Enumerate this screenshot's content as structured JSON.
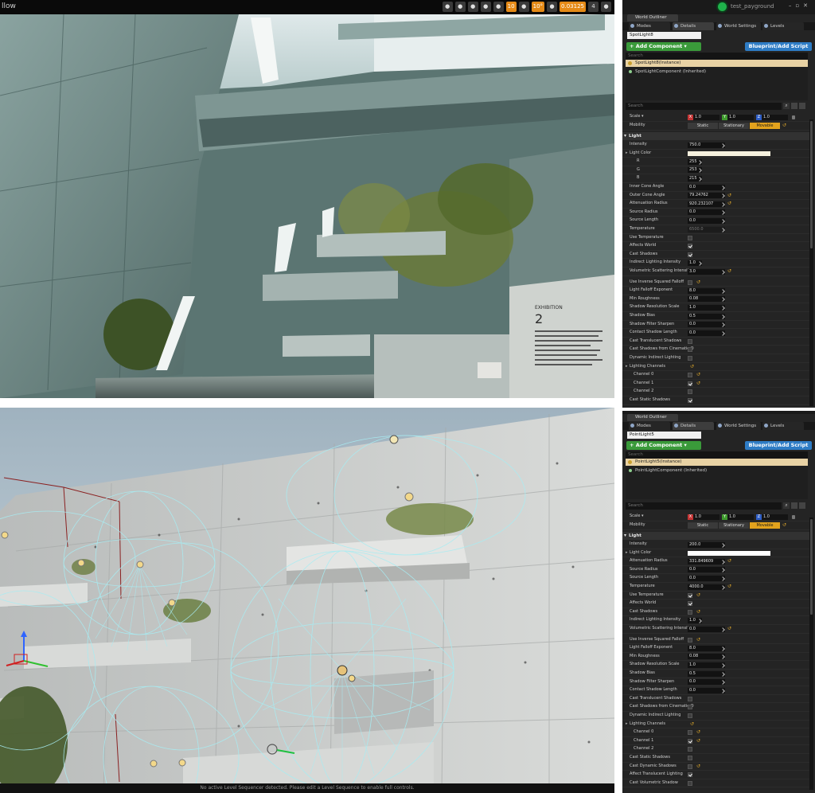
{
  "viewport_top": {
    "mode_label": "llow",
    "toolbar": [
      {
        "name": "translate-icon",
        "label": ""
      },
      {
        "name": "rotate-icon",
        "label": ""
      },
      {
        "name": "scale-icon",
        "label": ""
      },
      {
        "name": "world-icon",
        "label": ""
      },
      {
        "name": "snap-grid-icon",
        "label": ""
      },
      {
        "name": "grid-size",
        "label": "10"
      },
      {
        "name": "rotation-snap-icon",
        "label": ""
      },
      {
        "name": "rotation-snap-value",
        "label": "10°"
      },
      {
        "name": "scale-snap-icon",
        "label": ""
      },
      {
        "name": "scale-snap-value",
        "label": "0.03125"
      },
      {
        "name": "camera-speed",
        "label": "4"
      },
      {
        "name": "maximize-icon",
        "label": ""
      }
    ]
  },
  "viewport_bottom": {
    "status": "No active Level Sequencer detected. Please edit a Level Sequence to enable full controls."
  },
  "panel1": {
    "project": "test_payground",
    "outliner_tab": "World Outliner",
    "tabs": [
      "Modes",
      "Details",
      "World Settings",
      "Levels"
    ],
    "object_name": "SpotLight8",
    "add_component": "+ Add Component ▾",
    "blueprint_button": "Blueprint/Add Script",
    "search_placeholder": "Search",
    "instance": "SpotLight8(Instance)",
    "component": "SpotLightComponent (Inherited)",
    "details_search": "Search",
    "transform": {
      "scale_label": "Scale ▾",
      "scale": [
        "1.0",
        "1.0",
        "1.0"
      ],
      "mobility_label": "Mobility",
      "mobility": [
        "Static",
        "Stationary",
        "Movable"
      ]
    },
    "light_category": "Light",
    "props": [
      {
        "label": "Intensity",
        "type": "num",
        "value": "750.0"
      },
      {
        "label": "Light Color",
        "type": "color",
        "arrow": true
      },
      {
        "label": "R",
        "type": "num",
        "value": "255",
        "indent": 1,
        "short": true
      },
      {
        "label": "G",
        "type": "num",
        "value": "253",
        "indent": 1,
        "short": true
      },
      {
        "label": "B",
        "type": "num",
        "value": "215",
        "indent": 1,
        "short": true
      },
      {
        "label": "Inner Cone Angle",
        "type": "num",
        "value": "0.0"
      },
      {
        "label": "Outer Cone Angle",
        "type": "num",
        "value": "79.24762",
        "reset": true
      },
      {
        "label": "Attenuation Radius",
        "type": "num",
        "value": "920.232107",
        "reset": true
      },
      {
        "label": "Source Radius",
        "type": "num",
        "value": "0.0"
      },
      {
        "label": "Source Length",
        "type": "num",
        "value": "0.0"
      },
      {
        "label": "Temperature",
        "type": "num",
        "value": "6500.0",
        "disabled": true
      },
      {
        "label": "Use Temperature",
        "type": "chk",
        "checked": false
      },
      {
        "label": "Affects World",
        "type": "chk",
        "checked": true
      },
      {
        "label": "Cast Shadows",
        "type": "chk",
        "checked": true
      },
      {
        "label": "Indirect Lighting Intensity",
        "type": "num",
        "value": "1.0",
        "short": true
      },
      {
        "label": "Volumetric Scattering Intensity",
        "type": "num",
        "value": "3.0",
        "reset": true
      },
      {
        "label": "",
        "type": "gap"
      },
      {
        "label": "Use Inverse Squared Falloff",
        "type": "chk",
        "checked": false,
        "reset": true
      },
      {
        "label": "Light Falloff Exponent",
        "type": "num",
        "value": "8.0"
      },
      {
        "label": "Min Roughness",
        "type": "num",
        "value": "0.08"
      },
      {
        "label": "Shadow Resolution Scale",
        "type": "num",
        "value": "1.0"
      },
      {
        "label": "Shadow Bias",
        "type": "num",
        "value": "0.5"
      },
      {
        "label": "Shadow Filter Sharpen",
        "type": "num",
        "value": "0.0"
      },
      {
        "label": "Contact Shadow Length",
        "type": "num",
        "value": "0.0"
      },
      {
        "label": "Cast Translucent Shadows",
        "type": "chk",
        "checked": false
      },
      {
        "label": "Cast Shadows from Cinematic O",
        "type": "chk",
        "checked": false
      },
      {
        "label": "Dynamic Indirect Lighting",
        "type": "chk",
        "checked": false
      },
      {
        "label": "Lighting Channels",
        "type": "group",
        "arrow": true,
        "reset": true
      },
      {
        "label": "Channel 0",
        "type": "chk",
        "checked": false,
        "indent": 2,
        "reset": true
      },
      {
        "label": "Channel 1",
        "type": "chk",
        "checked": true,
        "indent": 2,
        "reset": true
      },
      {
        "label": "Channel 2",
        "type": "chk",
        "checked": false,
        "indent": 2
      },
      {
        "label": "Cast Static Shadows",
        "type": "chk",
        "checked": true
      }
    ]
  },
  "panel2": {
    "outliner_tab": "World Outliner",
    "tabs": [
      "Modes",
      "Details",
      "World Settings",
      "Levels"
    ],
    "object_name": "PointLight5",
    "add_component": "+ Add Component ▾",
    "blueprint_button": "Blueprint/Add Script",
    "search_placeholder": "Search",
    "instance": "PointLight5(Instance)",
    "component": "PointLightComponent (Inherited)",
    "details_search": "Search",
    "transform": {
      "scale_label": "Scale ▾",
      "scale": [
        "1.0",
        "1.0",
        "1.0"
      ],
      "mobility_label": "Mobility",
      "mobility": [
        "Static",
        "Stationary",
        "Movable"
      ]
    },
    "light_category": "Light",
    "props": [
      {
        "label": "Intensity",
        "type": "num",
        "value": "200.0"
      },
      {
        "label": "Light Color",
        "type": "color",
        "arrow": true,
        "white": true
      },
      {
        "label": "Attenuation Radius",
        "type": "num",
        "value": "331.849609",
        "reset": true
      },
      {
        "label": "Source Radius",
        "type": "num",
        "value": "0.0"
      },
      {
        "label": "Source Length",
        "type": "num",
        "value": "0.0"
      },
      {
        "label": "Temperature",
        "type": "num",
        "value": "4000.0",
        "reset": true
      },
      {
        "label": "Use Temperature",
        "type": "chk",
        "checked": true,
        "reset": true
      },
      {
        "label": "Affects World",
        "type": "chk",
        "checked": true
      },
      {
        "label": "Cast Shadows",
        "type": "chk",
        "checked": false,
        "reset": true
      },
      {
        "label": "Indirect Lighting Intensity",
        "type": "num",
        "value": "1.0",
        "short": true
      },
      {
        "label": "Volumetric Scattering Intensity",
        "type": "num",
        "value": "0.0",
        "reset": true
      },
      {
        "label": "",
        "type": "gap"
      },
      {
        "label": "Use Inverse Squared Falloff",
        "type": "chk",
        "checked": false,
        "reset": true
      },
      {
        "label": "Light Falloff Exponent",
        "type": "num",
        "value": "8.0"
      },
      {
        "label": "Min Roughness",
        "type": "num",
        "value": "0.08"
      },
      {
        "label": "Shadow Resolution Scale",
        "type": "num",
        "value": "1.0"
      },
      {
        "label": "Shadow Bias",
        "type": "num",
        "value": "0.5"
      },
      {
        "label": "Shadow Filter Sharpen",
        "type": "num",
        "value": "0.0"
      },
      {
        "label": "Contact Shadow Length",
        "type": "num",
        "value": "0.0"
      },
      {
        "label": "Cast Translucent Shadows",
        "type": "chk",
        "checked": false
      },
      {
        "label": "Cast Shadows from Cinematic O",
        "type": "chk",
        "checked": false
      },
      {
        "label": "Dynamic Indirect Lighting",
        "type": "chk",
        "checked": false
      },
      {
        "label": "Lighting Channels",
        "type": "group",
        "arrow": true,
        "reset": true
      },
      {
        "label": "Channel 0",
        "type": "chk",
        "checked": false,
        "indent": 2,
        "reset": true
      },
      {
        "label": "Channel 1",
        "type": "chk",
        "checked": true,
        "indent": 2,
        "reset": true
      },
      {
        "label": "Channel 2",
        "type": "chk",
        "checked": false,
        "indent": 2
      },
      {
        "label": "Cast Static Shadows",
        "type": "chk",
        "checked": false
      },
      {
        "label": "Cast Dynamic Shadows",
        "type": "chk",
        "checked": false,
        "reset": true
      },
      {
        "label": "Affect Translucent Lighting",
        "type": "chk",
        "checked": true
      },
      {
        "label": "Cast Volumetric Shadow",
        "type": "chk",
        "checked": false
      }
    ]
  },
  "colors": {
    "panel_bg": "#242424",
    "add_component": "#3a9a3a",
    "blueprint": "#2e7cc5",
    "movable_active": "#e3a31d",
    "instance_row": "#e8d2a4",
    "light_radius_lines": "#a8ecf2"
  }
}
